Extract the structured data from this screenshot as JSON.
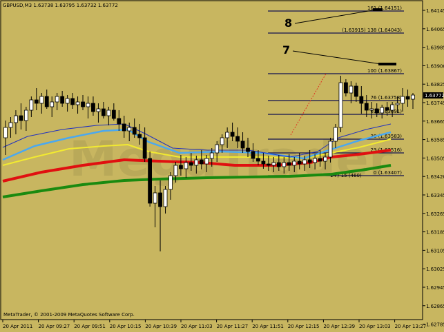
{
  "header": {
    "symbol_info": "GBPUSD,M3  1.63738 1.63795 1.63732 1.63772"
  },
  "footer": {
    "copyright": "MetaTrader, © 2001-2009 MetaQuotes Software Corp."
  },
  "watermark": "MegaTrader",
  "colors": {
    "background": "#c8b660",
    "ma_green": "#1a8a10",
    "ma_red": "#e01010",
    "ma_yellow": "#f2ea30",
    "ma_skyblue": "#4aa8f0",
    "ma_blue": "#2030c0",
    "fib_line": "#101050",
    "fib_trend": "#e03020"
  },
  "price_scale": {
    "labels": [
      "1.64145",
      "1.64065",
      "1.63985",
      "1.63900",
      "1.63825",
      "1.63745",
      "1.63665",
      "1.63585",
      "1.63505",
      "1.63420",
      "1.63345",
      "1.63265",
      "1.63185",
      "1.63105",
      "1.63025",
      "1.62945",
      "1.62865",
      "1.62785"
    ],
    "current_price": "1.63772"
  },
  "time_scale": {
    "labels": [
      "20 Apr 2011",
      "20 Apr 09:27",
      "20 Apr 09:51",
      "20 Apr 10:15",
      "20 Apr 10:39",
      "20 Apr 11:03",
      "20 Apr 11:27",
      "20 Apr 11:51",
      "20 Apr 12:15",
      "20 Apr 12:39",
      "20 Apr 13:03",
      "20 Apr 13:27"
    ]
  },
  "fibonacci": {
    "levels": [
      "161 (1.64151)",
      "(1.63915) 138 (1.64043)",
      "100 (1.63867)",
      "76 (1.63758)",
      "61 (1.63691)",
      "38 (1.63583)",
      "23 (1.63516)",
      "0 (1.63407)"
    ],
    "range_label": "14 / 15 (460)"
  },
  "annotations": {
    "label_8": "8",
    "label_7": "7"
  }
}
